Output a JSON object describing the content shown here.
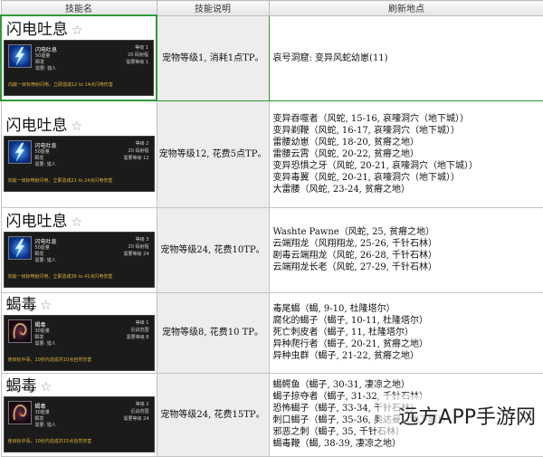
{
  "headers": [
    "技能名",
    "技能说明",
    "刷新地点"
  ],
  "rows": [
    {
      "skill": "闪电吐息",
      "icon": "lightning-icon",
      "card": {
        "name": "闪电吐息",
        "rank": "等级 1",
        "cost": "50能量",
        "range": "20 码射程",
        "cast": "瞬发",
        "need": "需要: 猎人",
        "req": "需要等级 1",
        "desc": "向敌一目标喷射闪电，立即造成12 to 14点闪电伤害"
      },
      "desc": "宠物等级1, 消耗1点TP。",
      "locations": [
        "哀号洞窟: 变异风蛇幼崽(11)"
      ]
    },
    {
      "skill": "闪电吐息",
      "icon": "lightning-icon",
      "card": {
        "name": "闪电吐息",
        "rank": "等级 2",
        "cost": "50能量",
        "range": "20 码射程",
        "cast": "瞬发",
        "need": "需要: 猎人",
        "req": "需要等级 12",
        "desc": "向敌一目标喷射闪电，立即造成21 to 24点闪电伤害"
      },
      "desc": "宠物等级12, 花费5点TP。",
      "locations": [
        "变异吞噬者（风蛇, 15-16, 哀嚎洞穴（地下城））",
        "变异剃鞭（风蛇, 16-17, 哀嚎洞穴（地下城））",
        "雷腰幼崽（风蛇, 18-20, 贫瘠之地）",
        "雷腰云霄（风蛇, 20-22, 贫瘠之地）",
        "变异恐惧之牙（风蛇, 20-21, 哀嚎洞穴（地下城））",
        "变异毒翼（风蛇, 20-21, 哀嚎洞穴（地下城））",
        "大雷腰（风蛇, 23-24, 贫瘠之地）"
      ]
    },
    {
      "skill": "闪电吐息",
      "icon": "lightning-icon",
      "card": {
        "name": "闪电吐息",
        "rank": "等级 3",
        "cost": "50能量",
        "range": "20 码射程",
        "cast": "瞬发",
        "need": "需要: 猎人",
        "req": "需要等级 24",
        "desc": "向敌一目标喷射闪电，立即造成36 to 41点闪电伤害"
      },
      "desc": "宠物等级24, 花费10TP。",
      "locations": [
        "Washte Pawne（风蛇, 25, 贫瘠之地）",
        "云端翔龙（风翔翔龙, 25-26, 千针石林）",
        "剧毒云端翔龙（风蛇, 26-28, 千针石林）",
        "云端翔龙长老（风蛇, 27-29, 千针石林）"
      ]
    },
    {
      "skill": "蝎毒",
      "icon": "poison-icon",
      "card": {
        "name": "蝎毒",
        "rank": "等级 1",
        "cost": "30能量",
        "range": "近战范围",
        "cast": "瞬发",
        "need": "需要: 猎人",
        "req": "需要等级 8",
        "desc": "使目标中毒，10秒内造成共10点自然伤害"
      },
      "desc": "宠物等级8, 花费10 TP。",
      "locations": [
        "毒尾蝎（蝎, 9-10, 杜隆塔尔）",
        "腐化的蝎子（蝎子, 10-11, 杜隆塔尔）",
        "死亡刺皮者（蝎子, 11, 杜隆塔尔）",
        "异种爬行者（蝎子, 20-21, 贫瘠之地）",
        "异种虫群（蝎子, 21-22, 贫瘠之地）"
      ]
    },
    {
      "skill": "蝎毒",
      "icon": "poison-icon",
      "card": {
        "name": "蝎毒",
        "rank": "等级 2",
        "cost": "30能量",
        "range": "近战范围",
        "cast": "瞬发",
        "need": "需要: 猎人",
        "req": "需要等级 24",
        "desc": "使目标中毒，10秒内造成共15点自然伤害"
      },
      "desc": "宠物等级24, 花费15TP。",
      "locations": [
        "蝎鳄鱼（蝎子, 30-31, 凄凉之地）",
        "蝎子掠夺者（蝎子, 31-32, 千针石林）",
        "恐怖蝎子（蝎子, 33-34, 千针石林）",
        "刺口蝎子（蝎子, 35-36, 奥达曼（地下城））",
        "邪恶之刺（蝎子, 35, 千针石林）",
        "蝎毒鞭（蝎, 38-39, 凄凉之地）"
      ]
    }
  ],
  "watermark": "远方APP手游网"
}
